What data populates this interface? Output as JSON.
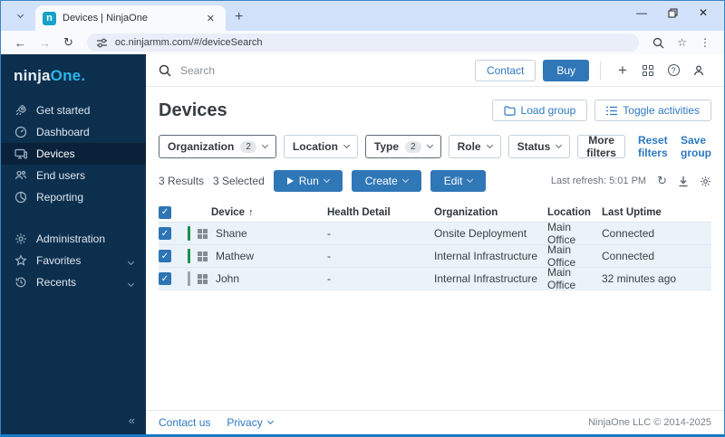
{
  "browser": {
    "tab_title": "Devices | NinjaOne",
    "favicon_letter": "n",
    "url": "oc.ninjarmm.com/#/deviceSearch"
  },
  "sidebar": {
    "logo_ninja": "ninja",
    "logo_one": "One.",
    "items": [
      {
        "label": "Get started"
      },
      {
        "label": "Dashboard"
      },
      {
        "label": "Devices"
      },
      {
        "label": "End users"
      },
      {
        "label": "Reporting"
      },
      {
        "label": "Administration"
      },
      {
        "label": "Favorites"
      },
      {
        "label": "Recents"
      }
    ]
  },
  "topbar": {
    "search_placeholder": "Search",
    "contact_label": "Contact",
    "buy_label": "Buy"
  },
  "page": {
    "title": "Devices",
    "load_group_label": "Load group",
    "toggle_activities_label": "Toggle activities"
  },
  "filters": {
    "items": [
      {
        "label": "Organization",
        "count": "2"
      },
      {
        "label": "Location",
        "count": ""
      },
      {
        "label": "Type",
        "count": "2"
      },
      {
        "label": "Role",
        "count": ""
      },
      {
        "label": "Status",
        "count": ""
      }
    ],
    "more_filters_label": "More filters",
    "reset_filters_label": "Reset filters",
    "save_group_label": "Save group"
  },
  "actions": {
    "results_text": "3 Results",
    "selected_text": "3 Selected",
    "run_label": "Run",
    "create_label": "Create",
    "edit_label": "Edit",
    "last_refresh": "Last refresh: 5:01 PM"
  },
  "table": {
    "columns": [
      "Device",
      "Health Detail",
      "Organization",
      "Location",
      "Last Uptime"
    ],
    "sort_indicator": "↑",
    "rows": [
      {
        "device": "Shane",
        "health": "-",
        "organization": "Onsite Deployment",
        "location": "Main Office",
        "last_uptime": "Connected",
        "status": "online"
      },
      {
        "device": "Mathew",
        "health": "-",
        "organization": "Internal Infrastructure",
        "location": "Main Office",
        "last_uptime": "Connected",
        "status": "online"
      },
      {
        "device": "John",
        "health": "-",
        "organization": "Internal Infrastructure",
        "location": "Main Office",
        "last_uptime": "32 minutes ago",
        "status": "offline"
      }
    ]
  },
  "footer": {
    "contact_us_label": "Contact us",
    "privacy_label": "Privacy",
    "copyright": "NinjaOne LLC © 2014-2025"
  },
  "colors": {
    "brand_navy": "#0c2f4e",
    "brand_cyan": "#2bb5e8",
    "primary_blue": "#3077b7",
    "status_online": "#1e8e4d",
    "status_offline": "#9aa5ad",
    "selected_row_bg": "#eaf2fa"
  }
}
